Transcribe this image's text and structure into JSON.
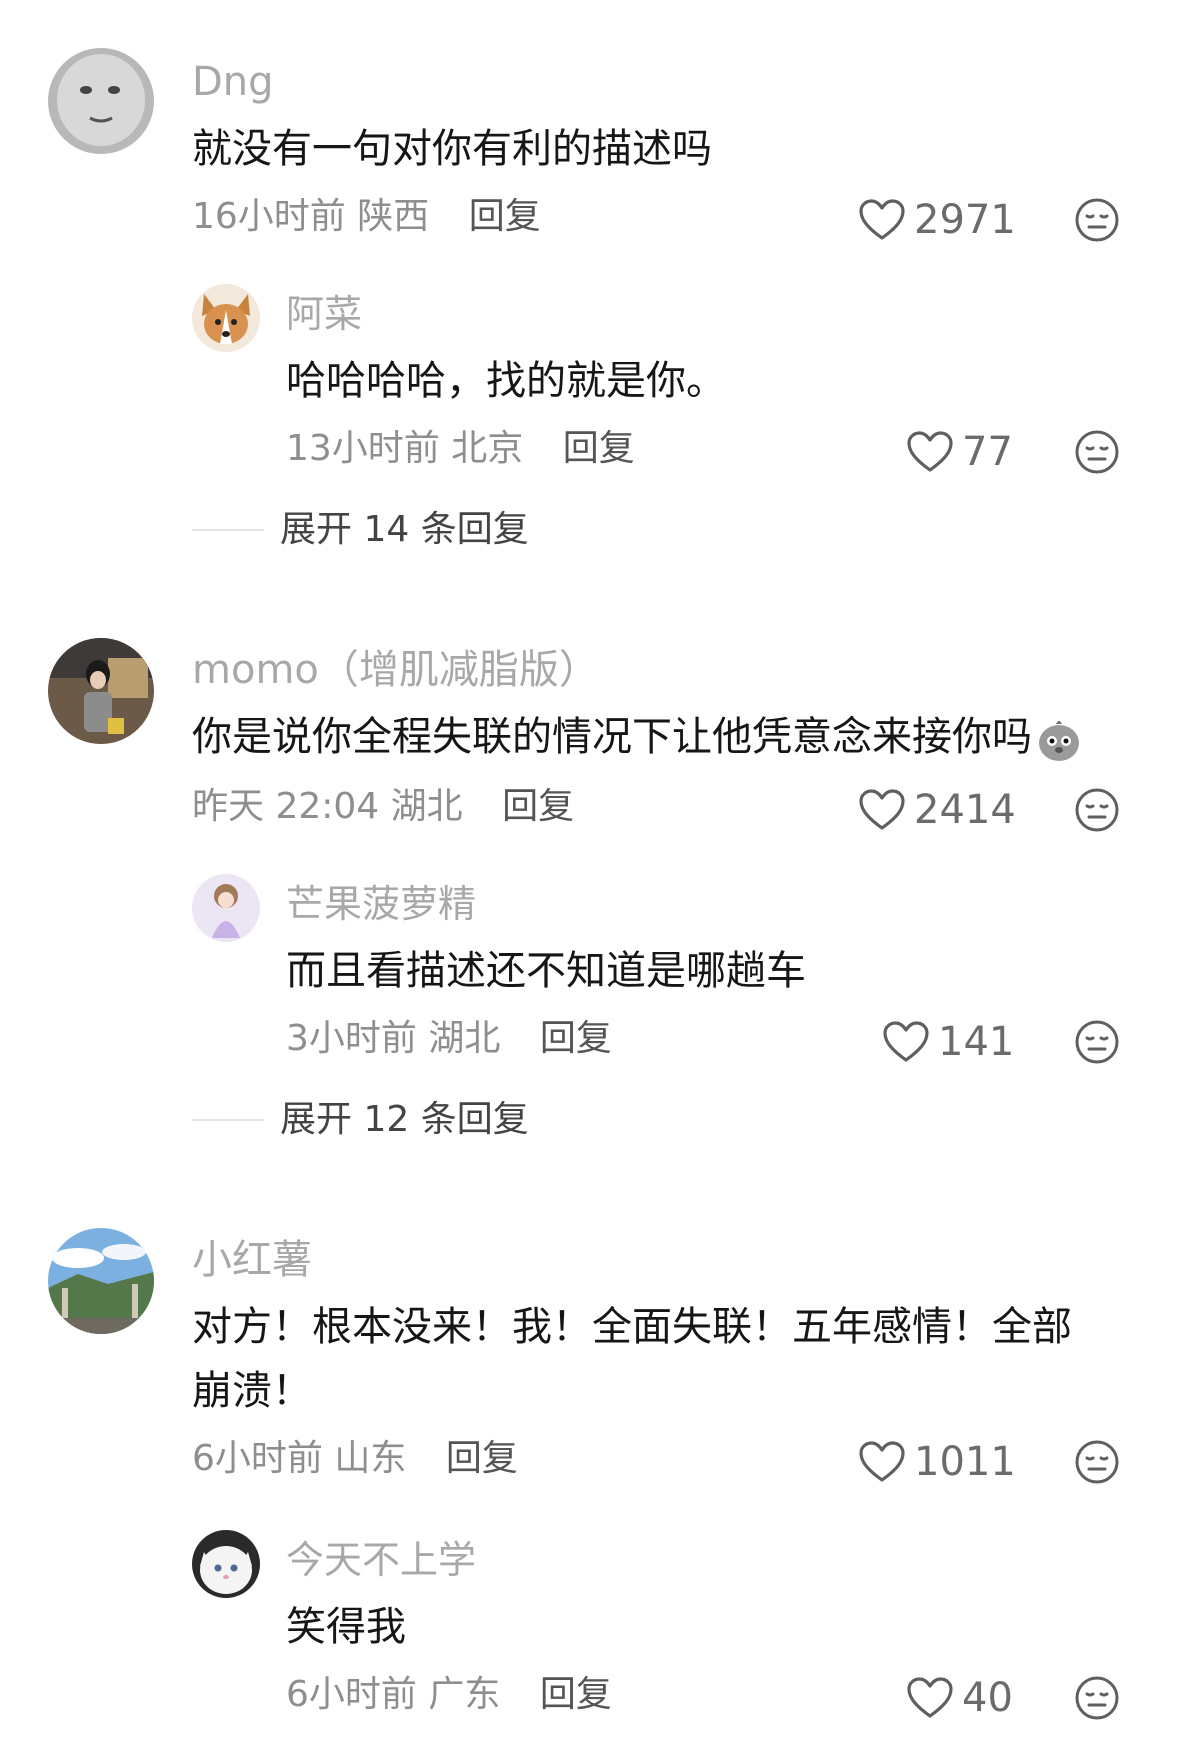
{
  "comments": [
    {
      "user": "Dng",
      "text": "就没有一句对你有利的描述吗",
      "time": "16小时前",
      "location": "陕西",
      "reply_label": "回复",
      "likes": "2971",
      "reply": {
        "user": "阿菜",
        "text": "哈哈哈哈，找的就是你。",
        "time": "13小时前",
        "location": "北京",
        "reply_label": "回复",
        "likes": "77"
      },
      "expand_label": "展开 14 条回复"
    },
    {
      "user": "momo（增肌减脂版）",
      "text": "你是说你全程失联的情况下让他凭意念来接你吗",
      "time": "昨天 22:04",
      "location": "湖北",
      "reply_label": "回复",
      "likes": "2414",
      "reply": {
        "user": "芒果菠萝精",
        "text": "而且看描述还不知道是哪趟车",
        "time": "3小时前",
        "location": "湖北",
        "reply_label": "回复",
        "likes": "141"
      },
      "expand_label": "展开 12 条回复"
    },
    {
      "user": "小红薯",
      "text_line1": "对方！根本没来！我！全面失联！五年感情！全部",
      "text_line2": "崩溃！",
      "time": "6小时前",
      "location": "山东",
      "reply_label": "回复",
      "likes": "1011",
      "reply": {
        "user": "今天不上学",
        "text": "笑得我",
        "time": "6小时前",
        "location": "广东",
        "reply_label": "回复",
        "likes": "40"
      }
    }
  ],
  "colors": {
    "username": "#a8a8a8",
    "text": "#161616",
    "meta": "#8e8e8e",
    "icon": "#6b6b6b"
  }
}
